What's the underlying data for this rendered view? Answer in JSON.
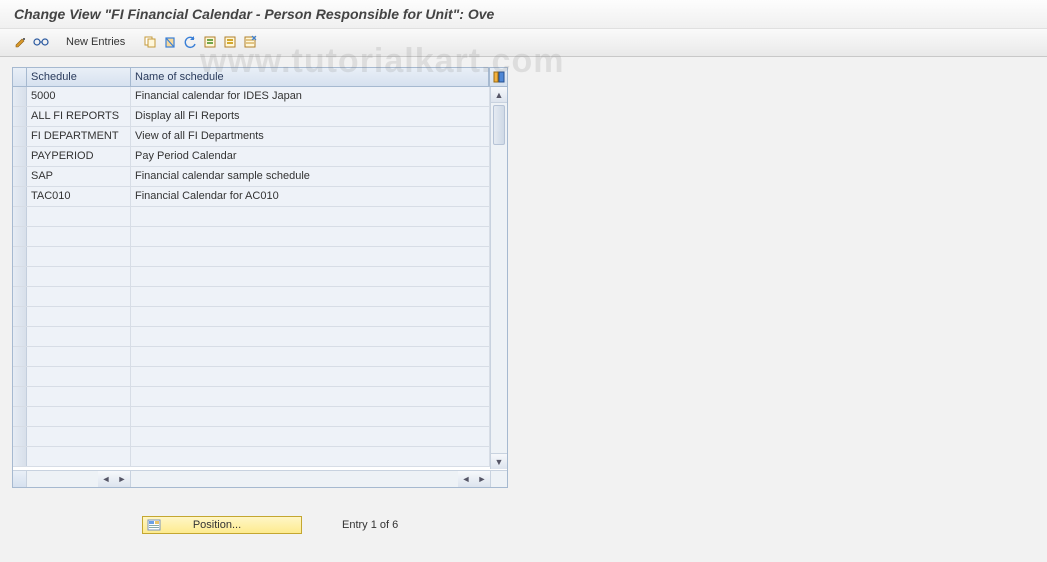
{
  "title": "Change View \"FI Financial Calendar - Person Responsible for Unit\": Ove",
  "watermark": "www.tutorialkart.com",
  "toolbar": {
    "new_entries": "New Entries"
  },
  "table": {
    "headers": {
      "schedule": "Schedule",
      "name": "Name of schedule"
    },
    "rows": [
      {
        "schedule": "5000",
        "name": "Financial calendar for IDES Japan"
      },
      {
        "schedule": "ALL FI REPORTS",
        "name": "Display all FI Reports"
      },
      {
        "schedule": "FI DEPARTMENT",
        "name": "View of all FI Departments"
      },
      {
        "schedule": "PAYPERIOD",
        "name": "Pay Period Calendar"
      },
      {
        "schedule": "SAP",
        "name": "Financial calendar sample schedule"
      },
      {
        "schedule": "TAC010",
        "name": "Financial Calendar for AC010"
      }
    ],
    "empty_row_count": 13
  },
  "footer": {
    "position_label": "Position...",
    "entry_text": "Entry 1 of 6"
  }
}
